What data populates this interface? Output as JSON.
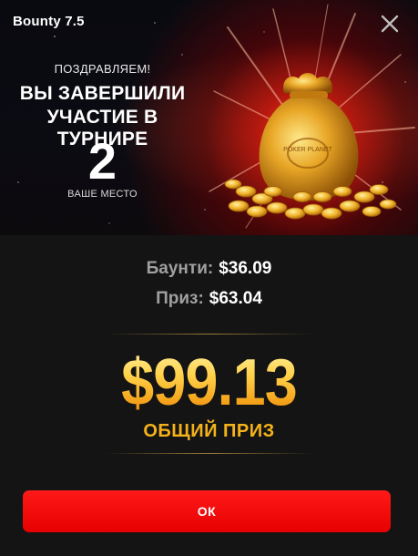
{
  "window": {
    "title": "Bounty 7.5"
  },
  "banner": {
    "congrats": "ПОЗДРАВЛЯЕМ!",
    "headline_line1": "ВЫ ЗАВЕРШИЛИ",
    "headline_line2": "УЧАСТИЕ В ТУРНИРЕ",
    "place": "2",
    "place_label": "ВАШЕ МЕСТО",
    "bag_text": "POKER PLANET"
  },
  "stats": {
    "bounty_label": "Баунти:",
    "bounty_value": "$36.09",
    "prize_label": "Приз:",
    "prize_value": "$63.04"
  },
  "total": {
    "amount": "$99.13",
    "label": "ОБЩИЙ ПРИЗ"
  },
  "actions": {
    "ok_label": "ОК"
  },
  "colors": {
    "background": "#141414",
    "accent_red": "#ff0000",
    "gold": "#f4b21a"
  },
  "icons": {
    "close": "close-icon",
    "reward": "money-bag-icon"
  }
}
